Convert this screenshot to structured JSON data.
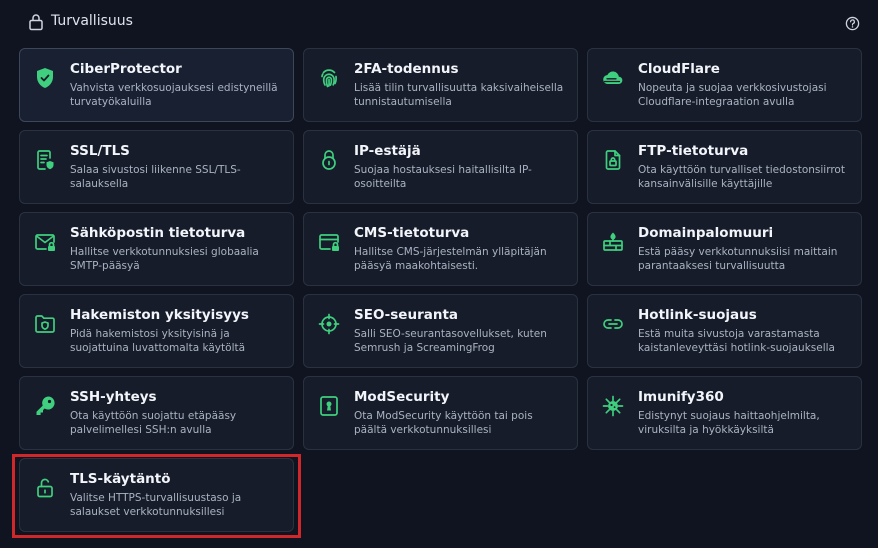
{
  "header": {
    "title": "Turvallisuus",
    "lock_icon": "lock-icon",
    "help_icon": "help-circle-icon"
  },
  "colors": {
    "background": "#0f1420",
    "card": "#161c29",
    "accent": "#3fcf7f",
    "highlight": "#d0272b"
  },
  "cards": [
    {
      "title": "CiberProtector",
      "desc": "Vahvista verkkosuojauksesi edistyneillä turvatyökaluilla",
      "icon": "shield-check-icon"
    },
    {
      "title": "2FA-todennus",
      "desc": "Lisää tilin turvallisuutta kaksivaiheisella tunnistautumisella",
      "icon": "fingerprint-icon"
    },
    {
      "title": "CloudFlare",
      "desc": "Nopeuta ja suojaa verkkosivustojasi Cloudflare-integraation avulla",
      "icon": "cloud-icon"
    },
    {
      "title": "SSL/TLS",
      "desc": "Salaa sivustosi liikenne SSL/TLS-salauksella",
      "icon": "certificate-icon"
    },
    {
      "title": "IP-estäjä",
      "desc": "Suojaa hostauksesi haitallisilta IP-osoitteilta",
      "icon": "padlock-icon"
    },
    {
      "title": "FTP-tietoturva",
      "desc": "Ota käyttöön turvalliset tiedostonsiirrot kansainvälisille käyttäjille",
      "icon": "file-lock-icon"
    },
    {
      "title": "Sähköpostin tietoturva",
      "desc": "Hallitse verkkotunnuksiesi globaalia SMTP-pääsyä",
      "icon": "mail-lock-icon"
    },
    {
      "title": "CMS-tietoturva",
      "desc": "Hallitse CMS-järjestelmän ylläpitäjän pääsyä maakohtaisesti.",
      "icon": "window-lock-icon"
    },
    {
      "title": "Domainpalomuuri",
      "desc": "Estä pääsy verkkotunnuksiisi maittain parantaaksesi turvallisuutta",
      "icon": "firewall-icon"
    },
    {
      "title": "Hakemiston yksityisyys",
      "desc": "Pidä hakemistosi yksityisinä ja suojattuina luvattomalta käytöltä",
      "icon": "folder-shield-icon"
    },
    {
      "title": "SEO-seuranta",
      "desc": "Salli SEO-seurantasovellukset, kuten Semrush ja ScreamingFrog",
      "icon": "crosshair-icon"
    },
    {
      "title": "Hotlink-suojaus",
      "desc": "Estä muita sivustoja varastamasta kaistanleveyttäsi hotlink-suojauksella",
      "icon": "link-icon"
    },
    {
      "title": "SSH-yhteys",
      "desc": "Ota käyttöön suojattu etäpääsy palvelimellesi SSH:n avulla",
      "icon": "key-icon"
    },
    {
      "title": "ModSecurity",
      "desc": "Ota ModSecurity käyttöön tai pois päältä verkkotunnuksillesi",
      "icon": "keyhole-icon"
    },
    {
      "title": "Imunify360",
      "desc": "Edistynyt suojaus haittaohjelmilta, viruksilta ja hyökkäyksiltä",
      "icon": "virus-icon"
    },
    {
      "title": "TLS-käytäntö",
      "desc": "Valitse HTTPS-turvallisuustaso ja salaukset verkkotunnuksillesi",
      "icon": "unlock-icon"
    }
  ]
}
